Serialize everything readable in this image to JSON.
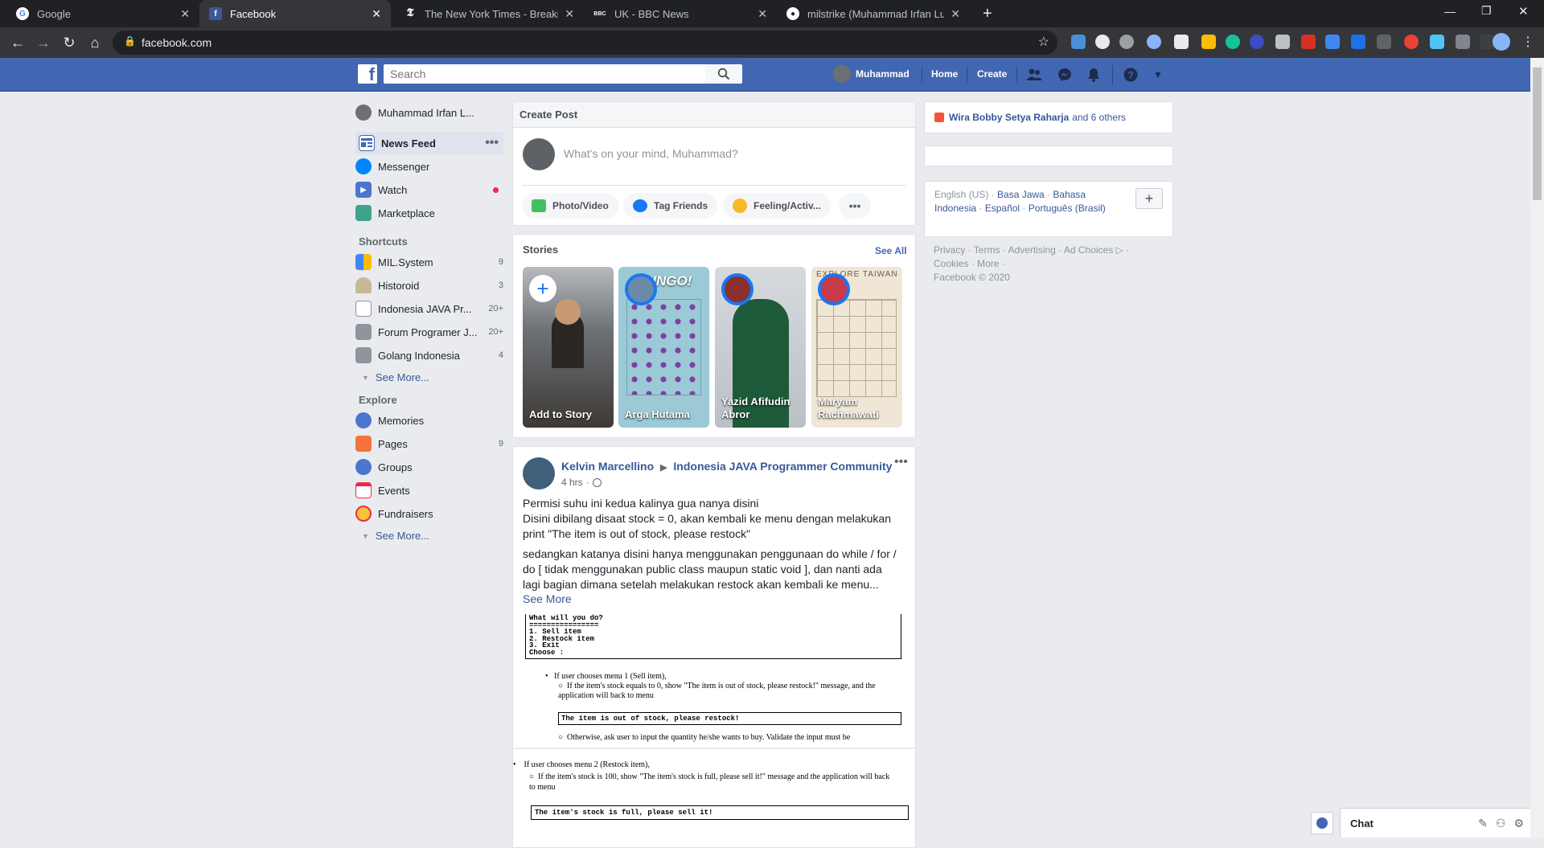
{
  "browser": {
    "tabs": [
      {
        "title": "Google",
        "icon": "google-icon"
      },
      {
        "title": "Facebook",
        "icon": "facebook-icon"
      },
      {
        "title": "The New York Times - Breaking N",
        "icon": "nyt-icon"
      },
      {
        "title": "UK - BBC News",
        "icon": "bbc-icon"
      },
      {
        "title": "milstrike (Muhammad Irfan Luthf",
        "icon": "github-icon"
      }
    ],
    "url": "facebook.com"
  },
  "header": {
    "search_placeholder": "Search",
    "profile_name": "Muhammad",
    "home": "Home",
    "create": "Create"
  },
  "sidebar": {
    "profile": "Muhammad Irfan L...",
    "main": [
      {
        "label": "News Feed",
        "color": "#4267b2"
      },
      {
        "label": "Messenger",
        "color": "#0084ff"
      },
      {
        "label": "Watch",
        "color": "#4a76d0"
      },
      {
        "label": "Marketplace",
        "color": "#40a38a"
      }
    ],
    "shortcuts_title": "Shortcuts",
    "shortcuts": [
      {
        "label": "MIL.System",
        "count": "9"
      },
      {
        "label": "Historoid",
        "count": "3"
      },
      {
        "label": "Indonesia JAVA Pr...",
        "count": "20+"
      },
      {
        "label": "Forum Programer J...",
        "count": "20+"
      },
      {
        "label": "Golang Indonesia",
        "count": "4"
      }
    ],
    "see_more_1": "See More...",
    "explore_title": "Explore",
    "explore": [
      {
        "label": "Memories",
        "count": ""
      },
      {
        "label": "Pages",
        "count": "9"
      },
      {
        "label": "Groups",
        "count": ""
      },
      {
        "label": "Events",
        "count": ""
      },
      {
        "label": "Fundraisers",
        "count": ""
      }
    ],
    "see_more_2": "See More..."
  },
  "create_post": {
    "title": "Create Post",
    "placeholder": "What's on your mind, Muhammad?",
    "photo": "Photo/Video",
    "tag": "Tag Friends",
    "feeling": "Feeling/Activ..."
  },
  "stories": {
    "title": "Stories",
    "see_all": "See All",
    "items": [
      {
        "name": "Add to Story"
      },
      {
        "name": "Arga Hutama"
      },
      {
        "name": "Yazid Afifudin Abror"
      },
      {
        "name": "Maryam Rachmawati"
      }
    ],
    "bingo": "BINGO!",
    "explore_taiwan": "EXPLORE TAIWAN"
  },
  "post": {
    "author": "Kelvin Marcellino",
    "group": "Indonesia JAVA Programmer Community",
    "time": "4 hrs",
    "p1": "Permisi suhu ini kedua kalinya gua nanya disini",
    "p2": "Disini dibilang disaat stock = 0, akan kembali ke menu dengan melakukan print \"The item is out of stock, please restock\"",
    "p3": "sedangkan katanya disini hanya menggunakan penggunaan do while / for / do [ tidak menggunakan public class maupun static void ], dan nanti ada lagi bagian dimana setelah melakukan restock akan kembali ke menu...",
    "see_more": "See More",
    "doc1": {
      "menu": [
        "What will you do?",
        "================",
        "1. Sell item",
        "2. Restock item",
        "3. Exit",
        "Choose :"
      ],
      "bullet": "If user chooses menu 1 (Sell item),",
      "sub": "If the item's stock equals to 0, show \"The item is out of stock, please restock!\" message, and the application will back to menu",
      "box": "The item is out of stock, please restock!",
      "other": "Otherwise, ask user to input the quantity he/she wants to buy. Validate the input must be"
    },
    "doc2": {
      "bullet": "If user chooses menu 2 (Restock item),",
      "sub": "If the item's stock is 100, show \"The item's stock is full, please sell it!\" message and the application will back to menu",
      "box": "The item's stock is full, please sell it!"
    }
  },
  "right": {
    "birthday_name": "Wira Bobby Setya Raharja",
    "birthday_rest": "and 6 others",
    "langs": {
      "current": "English (US)",
      "l1": "Basa Jawa",
      "l2": "Bahasa Indonesia",
      "l3": "Español",
      "l4": "Português (Brasil)"
    },
    "footer": {
      "privacy": "Privacy",
      "terms": "Terms",
      "advertising": "Advertising",
      "ad_choices": "Ad Choices",
      "cookies": "Cookies",
      "more": "More",
      "copyright": "Facebook © 2020"
    }
  },
  "chat": {
    "label": "Chat"
  }
}
